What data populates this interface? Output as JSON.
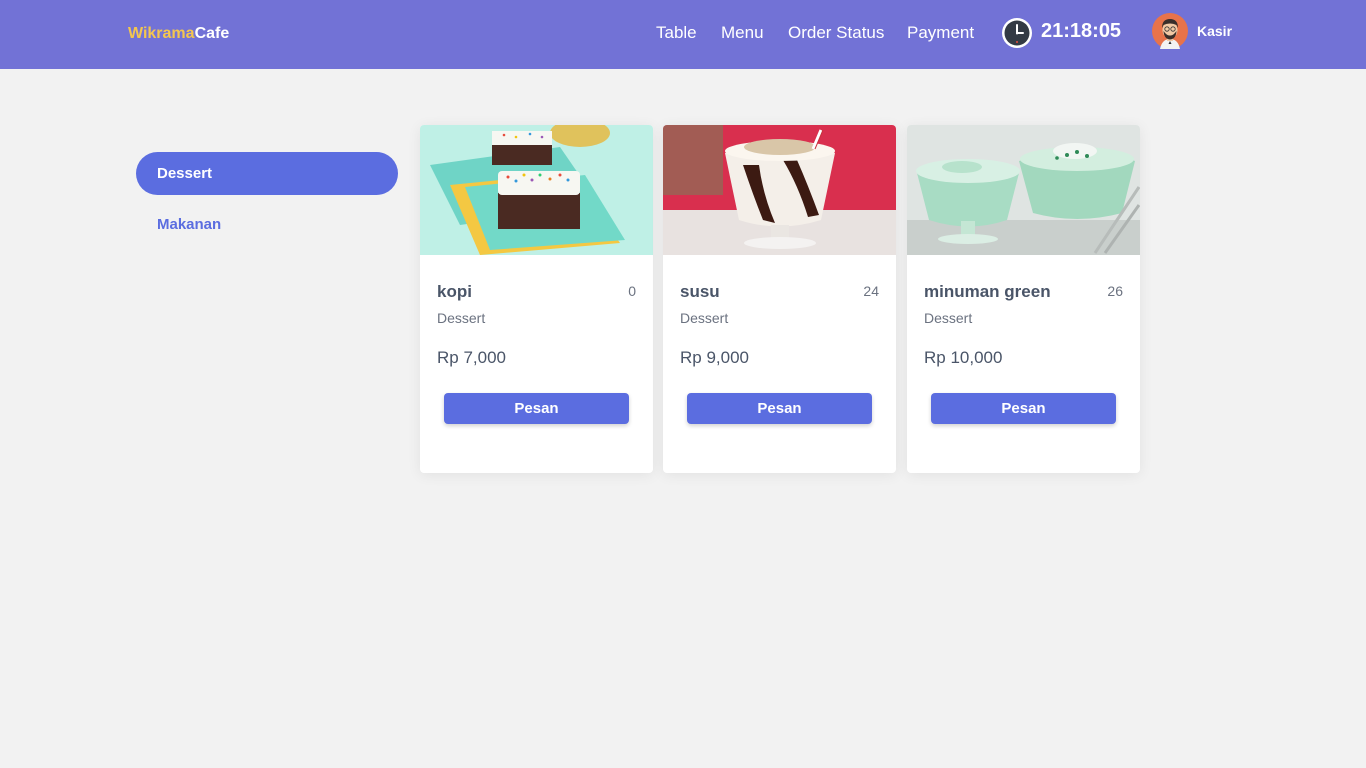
{
  "brand": {
    "part1": "Wikrama",
    "part2": "Cafe",
    "color_part1": "#f4c64e"
  },
  "nav": {
    "table": "Table",
    "menu": "Menu",
    "order_status": "Order Status",
    "payment": "Payment"
  },
  "clock": {
    "icon": "clock-icon",
    "time": "21:18:05"
  },
  "user": {
    "icon": "avatar-icon",
    "name": "Kasir"
  },
  "categories": [
    {
      "label": "Dessert",
      "active": true
    },
    {
      "label": "Makanan",
      "active": false
    }
  ],
  "products": [
    {
      "name": "kopi",
      "stock": "0",
      "category": "Dessert",
      "price": "Rp 7,000",
      "button": "Pesan",
      "image": "dessert-cake-image"
    },
    {
      "name": "susu",
      "stock": "24",
      "category": "Dessert",
      "price": "Rp 9,000",
      "button": "Pesan",
      "image": "chocolate-milkshake-image"
    },
    {
      "name": "minuman green",
      "stock": "26",
      "category": "Dessert",
      "price": "Rp 10,000",
      "button": "Pesan",
      "image": "green-drink-image"
    }
  ],
  "colors": {
    "navbar": "#7272d6",
    "accent": "#5b6de0",
    "background": "#f2f2f2"
  }
}
